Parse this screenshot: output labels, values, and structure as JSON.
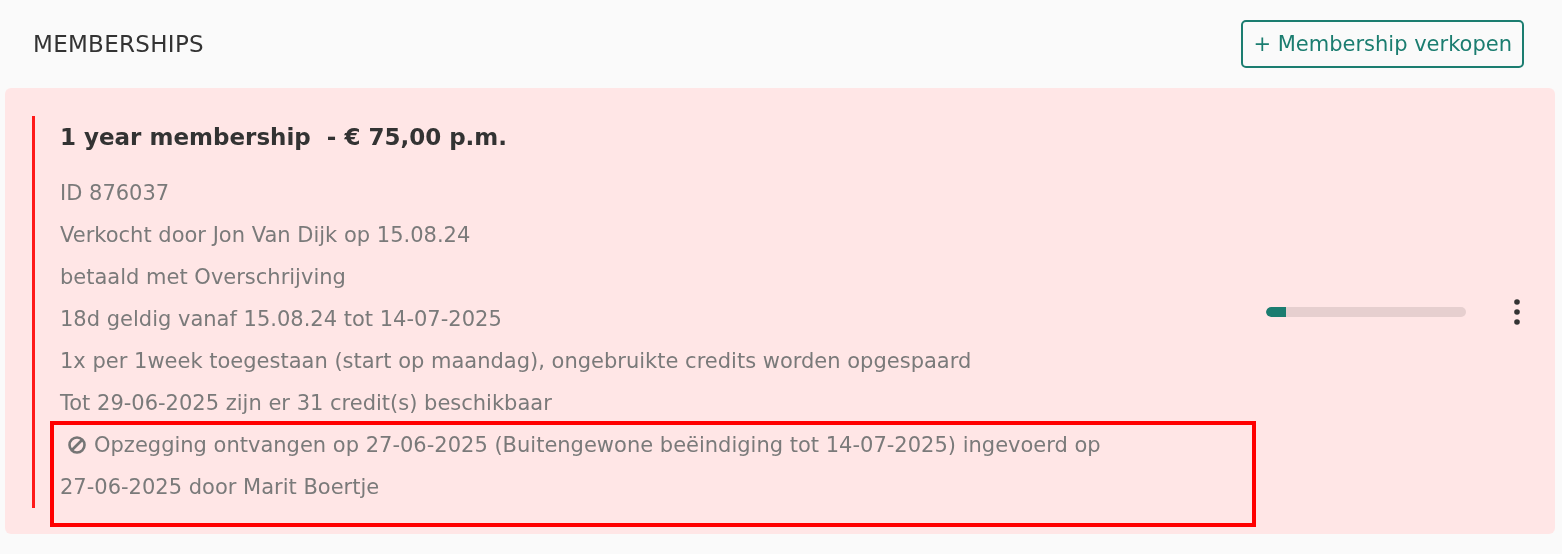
{
  "section": {
    "title": "MEMBERSHIPS",
    "action_button": "+ Membership verkopen"
  },
  "memberships": [
    {
      "title": "1 year membership  - € 75,00 p.m.",
      "cancelled": true,
      "details": [
        "ID 876037",
        "Verkocht door Jon Van Dijk op 15.08.24",
        "betaald met Overschrijving",
        "18d geldig vanaf 15.08.24 tot 14-07-2025",
        "1x per 1week toegestaan (start op maandag), ongebruikte credits worden opgespaard",
        "Tot 29-06-2025 zijn er 31 credit(s) beschikbaar"
      ],
      "cancellation": {
        "lines": [
          "Opzegging ontvangen op 27-06-2025 (Buitengewone beëindiging tot 14-07-2025) ingevoerd op",
          "27-06-2025 door Marit Boertje"
        ],
        "highlighted": true
      },
      "progress": {
        "level": 0.1
      }
    }
  ]
}
